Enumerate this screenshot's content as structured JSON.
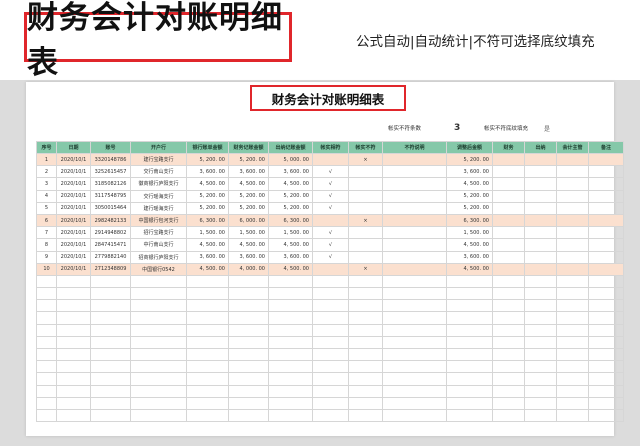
{
  "header": {
    "title": "财务会计对账明细表",
    "subtitle": "公式自动|自动统计|不符可选择底纹填充"
  },
  "sheet": {
    "title": "财务会计对账明细表",
    "summary": {
      "mismatch_label": "帐实不符条数",
      "mismatch_value": "3",
      "fill_label": "帐实不符底纹填充",
      "fill_value": "是"
    },
    "columns": [
      "序号",
      "日期",
      "账号",
      "开户行",
      "银行账单金额",
      "财务记账金额",
      "出纳记账金额",
      "帐实相符",
      "帐实不符",
      "不符说明",
      "调整后金额",
      "财务",
      "出纳",
      "会计主管",
      "备注"
    ],
    "rows": [
      {
        "no": "1",
        "date": "2020/10/1",
        "account": "3320148786",
        "bank": "建行宝路支行",
        "bank_amt": "5, 200. 00",
        "fin_amt": "5, 200. 00",
        "cash_amt": "5, 000. 00",
        "match": "",
        "mismatch": "×",
        "note": "",
        "adjusted": "5, 200. 00",
        "highlight": true
      },
      {
        "no": "2",
        "date": "2020/10/1",
        "account": "3252615457",
        "bank": "交行南山支行",
        "bank_amt": "3, 600. 00",
        "fin_amt": "3, 600. 00",
        "cash_amt": "3, 600. 00",
        "match": "√",
        "mismatch": "",
        "note": "",
        "adjusted": "3, 600. 00",
        "highlight": false
      },
      {
        "no": "3",
        "date": "2020/10/1",
        "account": "3185082126",
        "bank": "徽商银行庐阳支行",
        "bank_amt": "4, 500. 00",
        "fin_amt": "4, 500. 00",
        "cash_amt": "4, 500. 00",
        "match": "√",
        "mismatch": "",
        "note": "",
        "adjusted": "4, 500. 00",
        "highlight": false
      },
      {
        "no": "4",
        "date": "2020/10/1",
        "account": "3117548795",
        "bank": "交行瑶海支行",
        "bank_amt": "5, 200. 00",
        "fin_amt": "5, 200. 00",
        "cash_amt": "5, 200. 00",
        "match": "√",
        "mismatch": "",
        "note": "",
        "adjusted": "5, 200. 00",
        "highlight": false
      },
      {
        "no": "5",
        "date": "2020/10/1",
        "account": "3050015464",
        "bank": "建行瑶海支行",
        "bank_amt": "5, 200. 00",
        "fin_amt": "5, 200. 00",
        "cash_amt": "5, 200. 00",
        "match": "√",
        "mismatch": "",
        "note": "",
        "adjusted": "5, 200. 00",
        "highlight": false
      },
      {
        "no": "6",
        "date": "2020/10/1",
        "account": "2982482133",
        "bank": "中国银行包河支行",
        "bank_amt": "6, 300. 00",
        "fin_amt": "6, 000. 00",
        "cash_amt": "6, 300. 00",
        "match": "",
        "mismatch": "×",
        "note": "",
        "adjusted": "6, 300. 00",
        "highlight": true
      },
      {
        "no": "7",
        "date": "2020/10/1",
        "account": "2914948802",
        "bank": "招行宝路支行",
        "bank_amt": "1, 500. 00",
        "fin_amt": "1, 500. 00",
        "cash_amt": "1, 500. 00",
        "match": "√",
        "mismatch": "",
        "note": "",
        "adjusted": "1, 500. 00",
        "highlight": false
      },
      {
        "no": "8",
        "date": "2020/10/1",
        "account": "2847415471",
        "bank": "中行南山支行",
        "bank_amt": "4, 500. 00",
        "fin_amt": "4, 500. 00",
        "cash_amt": "4, 500. 00",
        "match": "√",
        "mismatch": "",
        "note": "",
        "adjusted": "4, 500. 00",
        "highlight": false
      },
      {
        "no": "9",
        "date": "2020/10/1",
        "account": "2779882140",
        "bank": "招商银行庐阳支行",
        "bank_amt": "3, 600. 00",
        "fin_amt": "3, 600. 00",
        "cash_amt": "3, 600. 00",
        "match": "√",
        "mismatch": "",
        "note": "",
        "adjusted": "3, 600. 00",
        "highlight": false
      },
      {
        "no": "10",
        "date": "2020/10/1",
        "account": "2712348809",
        "bank": "中国银行0542",
        "bank_amt": "4, 500. 00",
        "fin_amt": "4, 000. 00",
        "cash_amt": "4, 500. 00",
        "match": "",
        "mismatch": "×",
        "note": "",
        "adjusted": "4, 500. 00",
        "highlight": true
      }
    ],
    "empty_rows": 12,
    "colors": {
      "header_bg": "#85c8a9",
      "highlight_bg": "#fbe0cf",
      "title_border": "#e0262b"
    }
  }
}
